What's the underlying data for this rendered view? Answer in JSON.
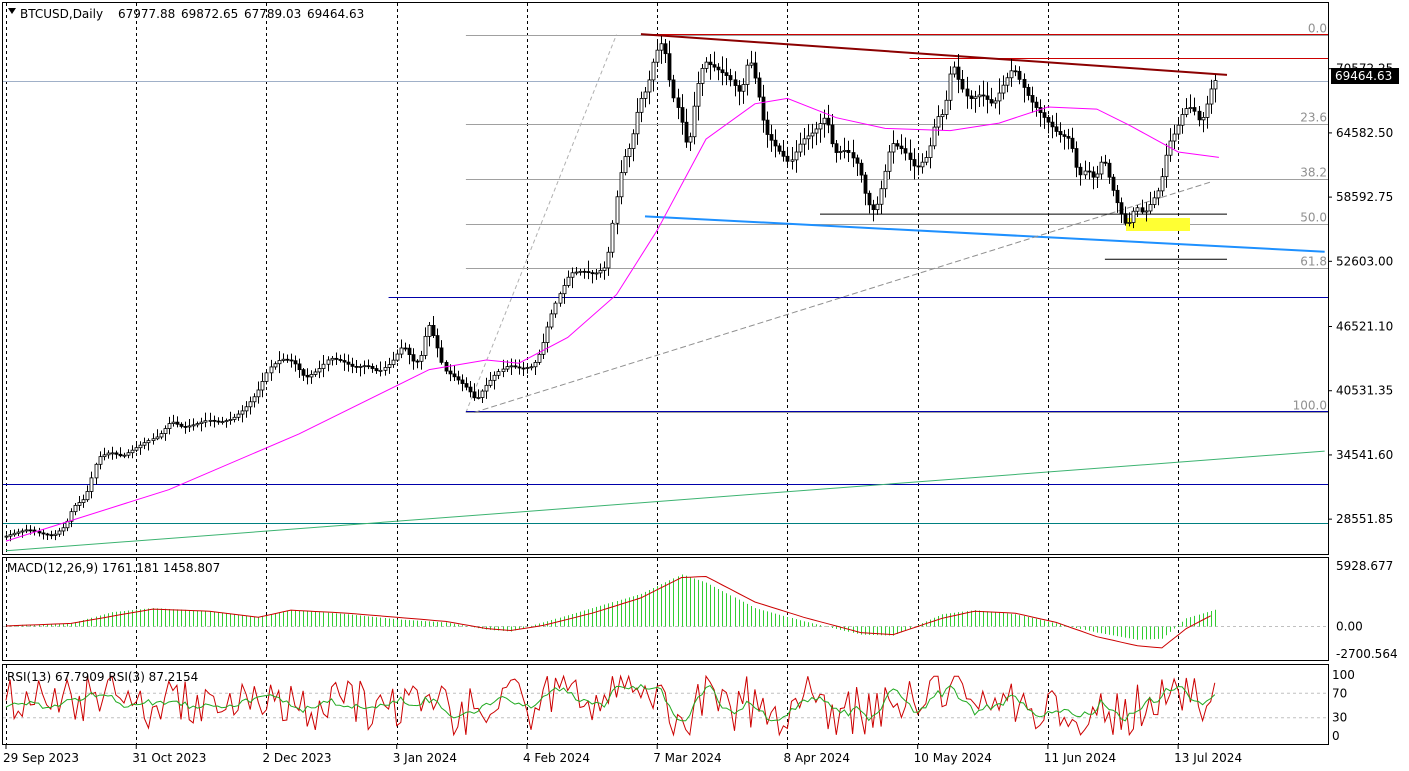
{
  "chart_data": {
    "type": "candlestick",
    "header": {
      "symbol": "BTCUSD,Daily",
      "open": "67977.88",
      "high": "69872.65",
      "low": "67789.03",
      "close": "69464.63"
    },
    "price_axis": {
      "ticks": [
        "70572.25",
        "64582.50",
        "58592.75",
        "52603.00",
        "46521.10",
        "40531.35",
        "34541.60",
        "28551.85"
      ],
      "range": [
        25300,
        76700
      ],
      "current_price": "69464.63"
    },
    "time_axis": {
      "labels": [
        "29 Sep 2023",
        "31 Oct 2023",
        "2 Dec 2023",
        "3 Jan 2024",
        "4 Feb 2024",
        "7 Mar 2024",
        "8 Apr 2024",
        "10 May 2024",
        "11 Jun 2024",
        "13 Jul 2024"
      ],
      "label_index": [
        0,
        32,
        64,
        96,
        128,
        160,
        192,
        224,
        256,
        288
      ],
      "total_bars": 298
    },
    "fibonacci": {
      "levels": [
        "0.0",
        "23.6",
        "38.2",
        "50.0",
        "61.8",
        "100.0"
      ],
      "ratios": [
        0,
        0.236,
        0.382,
        0.5,
        0.618,
        1.0
      ],
      "high_price": 73750,
      "low_price": 38500
    },
    "horizontal_lines": [
      {
        "price": 73800,
        "color": "#cc0000"
      },
      {
        "price": 71600,
        "color": "#cc0000"
      },
      {
        "price": 49300,
        "color": "#0000aa"
      },
      {
        "price": 38600,
        "color": "#0000aa"
      },
      {
        "price": 31800,
        "color": "#0000aa"
      },
      {
        "price": 28150,
        "color": "#008080"
      },
      {
        "price": 69464.63,
        "color": "#a0b0c8"
      }
    ],
    "trend_lines": [
      {
        "name": "resistance",
        "from": [
          156,
          73800
        ],
        "to": [
          300,
          70000
        ],
        "color": "#8b0000"
      },
      {
        "name": "support",
        "from": [
          157,
          56800
        ],
        "to": [
          324,
          53500
        ],
        "color": "#1e90ff"
      },
      {
        "name": "long-term",
        "from": [
          0,
          25600
        ],
        "to": [
          324,
          34900
        ],
        "color": "#3cb371"
      }
    ],
    "candle_points": [
      [
        0,
        26900
      ],
      [
        3,
        27300
      ],
      [
        6,
        27600
      ],
      [
        9,
        27200
      ],
      [
        12,
        27000
      ],
      [
        15,
        27900
      ],
      [
        17,
        29700
      ],
      [
        20,
        30500
      ],
      [
        23,
        34300
      ],
      [
        26,
        34800
      ],
      [
        29,
        34400
      ],
      [
        32,
        35100
      ],
      [
        35,
        35800
      ],
      [
        38,
        36300
      ],
      [
        41,
        37700
      ],
      [
        44,
        37100
      ],
      [
        47,
        37400
      ],
      [
        50,
        37800
      ],
      [
        53,
        37600
      ],
      [
        56,
        37900
      ],
      [
        59,
        38800
      ],
      [
        62,
        40200
      ],
      [
        65,
        42600
      ],
      [
        68,
        43500
      ],
      [
        71,
        43300
      ],
      [
        74,
        41700
      ],
      [
        77,
        42400
      ],
      [
        80,
        43600
      ],
      [
        83,
        43300
      ],
      [
        86,
        42700
      ],
      [
        89,
        42900
      ],
      [
        92,
        42300
      ],
      [
        95,
        43100
      ],
      [
        98,
        44800
      ],
      [
        101,
        43000
      ],
      [
        103,
        44100
      ],
      [
        104,
        47100
      ],
      [
        106,
        45200
      ],
      [
        108,
        42500
      ],
      [
        111,
        41700
      ],
      [
        114,
        40700
      ],
      [
        116,
        39600
      ],
      [
        118,
        40800
      ],
      [
        121,
        42200
      ],
      [
        124,
        42900
      ],
      [
        127,
        42600
      ],
      [
        130,
        42800
      ],
      [
        132,
        44300
      ],
      [
        134,
        47200
      ],
      [
        136,
        49200
      ],
      [
        139,
        51500
      ],
      [
        142,
        51700
      ],
      [
        145,
        51400
      ],
      [
        148,
        52100
      ],
      [
        150,
        57500
      ],
      [
        152,
        62000
      ],
      [
        154,
        63500
      ],
      [
        156,
        67500
      ],
      [
        158,
        68700
      ],
      [
        160,
        72000
      ],
      [
        162,
        73200
      ],
      [
        164,
        68300
      ],
      [
        166,
        66500
      ],
      [
        168,
        62800
      ],
      [
        170,
        68500
      ],
      [
        172,
        71300
      ],
      [
        175,
        70600
      ],
      [
        178,
        69800
      ],
      [
        181,
        68200
      ],
      [
        183,
        71800
      ],
      [
        185,
        69000
      ],
      [
        187,
        64700
      ],
      [
        190,
        63100
      ],
      [
        193,
        61700
      ],
      [
        196,
        63900
      ],
      [
        199,
        64700
      ],
      [
        202,
        66200
      ],
      [
        204,
        62700
      ],
      [
        207,
        63000
      ],
      [
        210,
        61500
      ],
      [
        212,
        58100
      ],
      [
        214,
        57200
      ],
      [
        216,
        60100
      ],
      [
        218,
        63700
      ],
      [
        221,
        63000
      ],
      [
        224,
        61200
      ],
      [
        227,
        62500
      ],
      [
        229,
        66000
      ],
      [
        231,
        66400
      ],
      [
        233,
        71300
      ],
      [
        235,
        69000
      ],
      [
        237,
        67700
      ],
      [
        240,
        68200
      ],
      [
        243,
        67200
      ],
      [
        246,
        69400
      ],
      [
        248,
        70700
      ],
      [
        250,
        69200
      ],
      [
        252,
        67700
      ],
      [
        254,
        66700
      ],
      [
        256,
        65800
      ],
      [
        259,
        64500
      ],
      [
        262,
        64000
      ],
      [
        264,
        60500
      ],
      [
        266,
        61200
      ],
      [
        268,
        60200
      ],
      [
        270,
        62400
      ],
      [
        272,
        59800
      ],
      [
        274,
        57500
      ],
      [
        276,
        55700
      ],
      [
        278,
        57800
      ],
      [
        280,
        57000
      ],
      [
        282,
        58200
      ],
      [
        284,
        59500
      ],
      [
        286,
        63500
      ],
      [
        288,
        64800
      ],
      [
        290,
        66800
      ],
      [
        292,
        67000
      ],
      [
        294,
        65400
      ],
      [
        296,
        67900
      ],
      [
        297,
        69464.63
      ]
    ],
    "ma_points": [
      [
        0,
        26500
      ],
      [
        40,
        31300
      ],
      [
        72,
        36500
      ],
      [
        104,
        42500
      ],
      [
        118,
        43400
      ],
      [
        126,
        43100
      ],
      [
        138,
        45500
      ],
      [
        150,
        49500
      ],
      [
        160,
        55500
      ],
      [
        172,
        64000
      ],
      [
        184,
        67300
      ],
      [
        192,
        67800
      ],
      [
        204,
        66000
      ],
      [
        216,
        65000
      ],
      [
        232,
        64800
      ],
      [
        244,
        65500
      ],
      [
        256,
        67000
      ],
      [
        268,
        66800
      ],
      [
        276,
        65300
      ],
      [
        288,
        62800
      ],
      [
        298,
        62300
      ]
    ],
    "macd": {
      "label": "MACD(12,26,9) 1761.181 1458.807",
      "ticks": [
        "5928.677",
        "0.00",
        "-2700.564"
      ],
      "range": [
        -2700.564,
        5928.677
      ],
      "histogram_points": [
        [
          0,
          100
        ],
        [
          16,
          300
        ],
        [
          26,
          1400
        ],
        [
          36,
          1800
        ],
        [
          50,
          1500
        ],
        [
          62,
          900
        ],
        [
          70,
          1600
        ],
        [
          84,
          1200
        ],
        [
          96,
          700
        ],
        [
          108,
          400
        ],
        [
          118,
          -300
        ],
        [
          124,
          -500
        ],
        [
          132,
          400
        ],
        [
          144,
          1800
        ],
        [
          156,
          3200
        ],
        [
          166,
          5100
        ],
        [
          172,
          4300
        ],
        [
          184,
          1800
        ],
        [
          196,
          500
        ],
        [
          210,
          -800
        ],
        [
          218,
          -900
        ],
        [
          230,
          1200
        ],
        [
          238,
          1600
        ],
        [
          248,
          1200
        ],
        [
          258,
          300
        ],
        [
          268,
          -600
        ],
        [
          278,
          -1300
        ],
        [
          284,
          -1200
        ],
        [
          290,
          800
        ],
        [
          298,
          1761.181
        ]
      ],
      "signal_points": [
        [
          0,
          50
        ],
        [
          16,
          300
        ],
        [
          26,
          1000
        ],
        [
          36,
          1700
        ],
        [
          50,
          1500
        ],
        [
          62,
          900
        ],
        [
          70,
          1600
        ],
        [
          84,
          1300
        ],
        [
          96,
          900
        ],
        [
          108,
          500
        ],
        [
          118,
          -200
        ],
        [
          124,
          -400
        ],
        [
          132,
          100
        ],
        [
          144,
          1300
        ],
        [
          156,
          2800
        ],
        [
          166,
          4800
        ],
        [
          172,
          4900
        ],
        [
          184,
          2400
        ],
        [
          196,
          900
        ],
        [
          210,
          -600
        ],
        [
          218,
          -800
        ],
        [
          230,
          800
        ],
        [
          238,
          1500
        ],
        [
          248,
          1300
        ],
        [
          258,
          400
        ],
        [
          268,
          -1000
        ],
        [
          278,
          -1900
        ],
        [
          284,
          -2100
        ],
        [
          290,
          -200
        ],
        [
          298,
          1458.807
        ]
      ]
    },
    "rsi": {
      "label": "RSI(13) 67.7909  RSI(3) 87.2154",
      "ticks": [
        "100",
        "70",
        "30",
        "0"
      ],
      "range": [
        0,
        100
      ],
      "rsi13_value": 67.7909,
      "rsi3_value": 87.2154
    }
  }
}
